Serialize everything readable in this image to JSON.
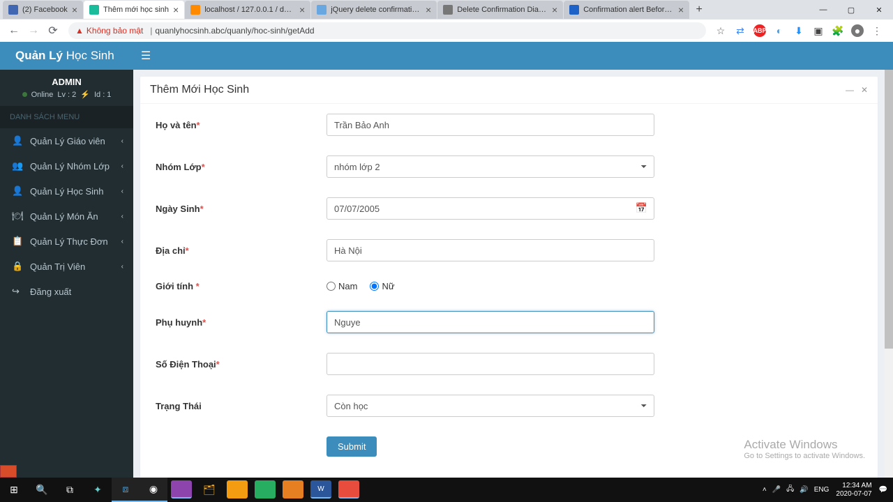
{
  "browser": {
    "tabs": [
      {
        "title": "(2) Facebook",
        "icon_bg": "#4267B2"
      },
      {
        "title": "Thêm mới học sinh",
        "icon_bg": "#1abc9c",
        "active": true
      },
      {
        "title": "localhost / 127.0.0.1 / db_qu",
        "icon_bg": "#ff8a00"
      },
      {
        "title": "jQuery delete confirmation b",
        "icon_bg": "#68a7e0"
      },
      {
        "title": "Delete Confirmation Dialog B",
        "icon_bg": "#777"
      },
      {
        "title": "Confirmation alert Before De",
        "icon_bg": "#1f62c7"
      }
    ],
    "warn_label": "Không bảo mật",
    "url": "quanlyhocsinh.abc/quanly/hoc-sinh/getAdd"
  },
  "brand": {
    "strong": "Quản Lý",
    "light": " Học Sinh"
  },
  "user": {
    "name": "ADMIN",
    "online": "Online",
    "lv": "Lv : 2",
    "id": "Id : 1"
  },
  "menu": {
    "header": "DANH SÁCH MENU",
    "items": [
      {
        "label": "Quản Lý Giáo viên",
        "icon": "👤"
      },
      {
        "label": "Quản Lý Nhóm Lớp",
        "icon": "👥"
      },
      {
        "label": "Quản Lý Học Sinh",
        "icon": "👤"
      },
      {
        "label": "Quản Lý Món Ăn",
        "icon": "🍽"
      },
      {
        "label": "Quản Lý Thực Đơn",
        "icon": "📋"
      },
      {
        "label": "Quản Trị Viên",
        "icon": "🔒"
      },
      {
        "label": "Đăng xuất",
        "icon": "↪",
        "noarrow": true
      }
    ]
  },
  "panel": {
    "title": "Thêm Mới Học Sinh"
  },
  "form": {
    "name_label": "Họ và tên",
    "name_value": "Trần Bảo Anh",
    "group_label": "Nhóm Lớp",
    "group_value": "nhóm lớp 2",
    "dob_label": "Ngày Sinh",
    "dob_value": "07/07/2005",
    "addr_label": "Địa chỉ",
    "addr_value": "Hà Nội",
    "gender_label": "Giới tính ",
    "gender_male": "Nam",
    "gender_female": "Nữ",
    "parent_label": "Phụ huynh",
    "parent_value": "Nguye",
    "phone_label": "Số Điện Thoại",
    "phone_value": "",
    "status_label": "Trạng Thái",
    "status_value": "Còn học",
    "submit": "Submit"
  },
  "watermark": {
    "l1": "Activate Windows",
    "l2": "Go to Settings to activate Windows."
  },
  "taskbar": {
    "lang": "ENG",
    "time": "12:34 AM",
    "date": "2020-07-07"
  }
}
